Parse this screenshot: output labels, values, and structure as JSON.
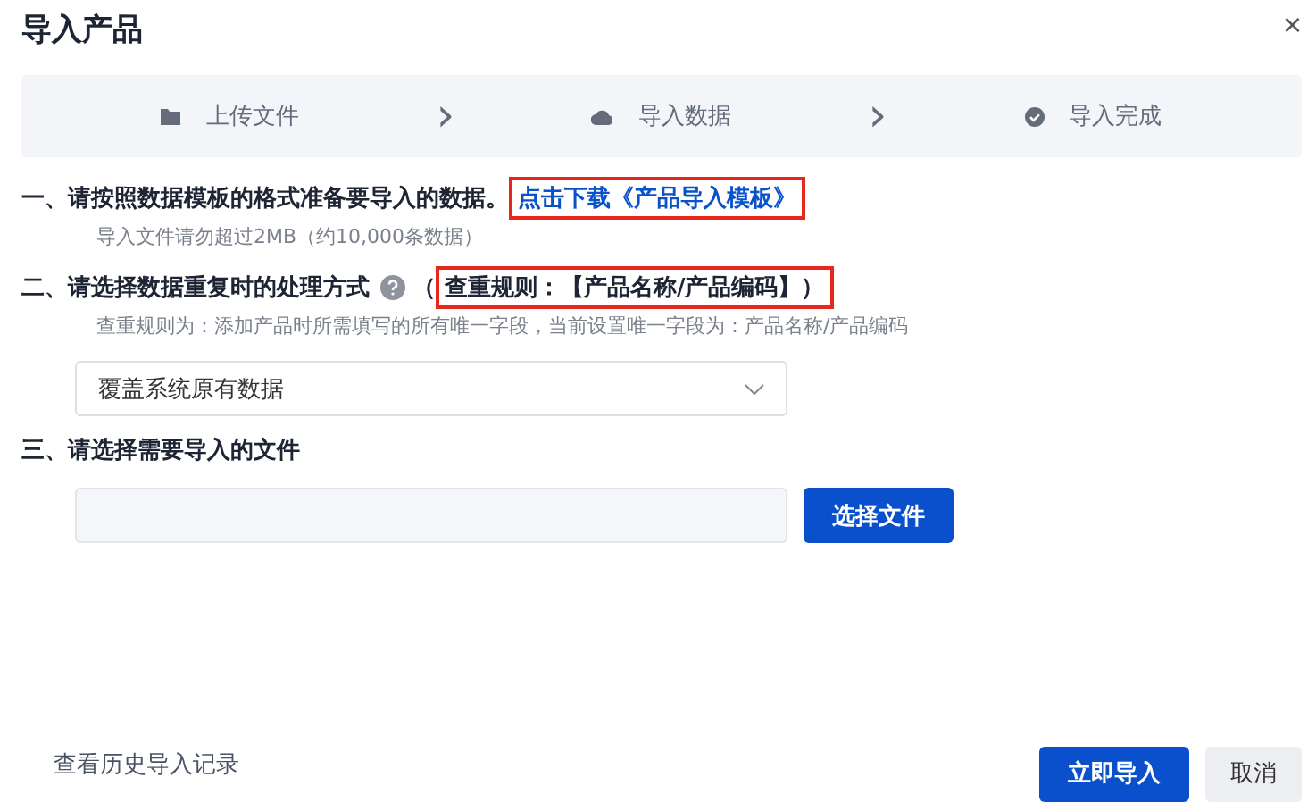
{
  "dialog": {
    "title": "导入产品",
    "close": "×"
  },
  "steps": [
    {
      "label": "上传文件"
    },
    {
      "label": "导入数据"
    },
    {
      "label": "导入完成"
    }
  ],
  "step_separator": "›",
  "section_1": {
    "heading": "一、请按照数据模板的格式准备要导入的数据。",
    "link": "点击下载《产品导入模板》",
    "link_highlighted": true,
    "hint": "导入文件请勿超过2MB（约10,000条数据）"
  },
  "section_2": {
    "heading": "二、请选择数据重复时的处理方式",
    "open_paren": "（",
    "rule": "查重规则：【产品名称/产品编码】）",
    "rule_highlighted": true,
    "hint": "查重规则为：添加产品时所需填写的所有唯一字段，当前设置唯一字段为：产品名称/产品编码",
    "select_value": "覆盖系统原有数据"
  },
  "section_3": {
    "heading": "三、请选择需要导入的文件",
    "choose_button": "选择文件"
  },
  "footer": {
    "history_link": "查看历史导入记录",
    "buttons": [
      {
        "label": "立即导入",
        "kind": "primary"
      },
      {
        "label": "取消",
        "kind": "secondary"
      }
    ]
  }
}
